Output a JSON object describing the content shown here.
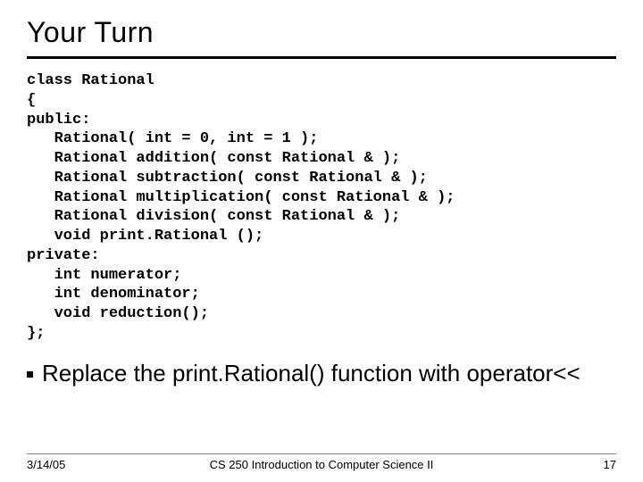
{
  "title": "Your Turn",
  "code_lines": [
    "class Rational",
    "{",
    "public:",
    "   Rational( int = 0, int = 1 );",
    "   Rational addition( const Rational & );",
    "   Rational subtraction( const Rational & );",
    "   Rational multiplication( const Rational & );",
    "   Rational division( const Rational & );",
    "   void print.Rational ();",
    "private:",
    "   int numerator;",
    "   int denominator;",
    "   void reduction();",
    "};"
  ],
  "bullet": "Replace the print.Rational() function with operator<<",
  "footer": {
    "date": "3/14/05",
    "course": "CS 250 Introduction to Computer Science II",
    "page": "17"
  }
}
